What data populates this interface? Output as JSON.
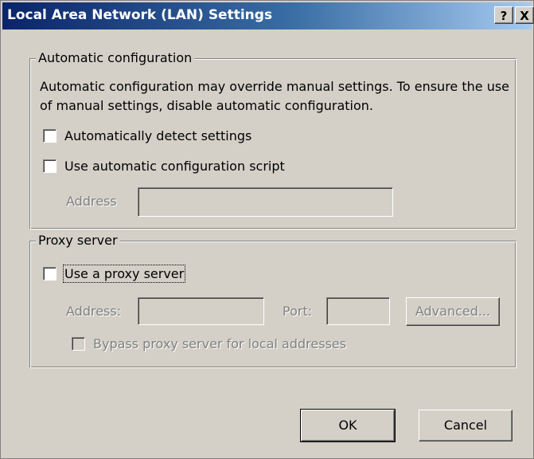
{
  "window": {
    "title": "Local Area Network (LAN) Settings",
    "help_label": "?",
    "close_label": "X"
  },
  "auto_config": {
    "legend": "Automatic configuration",
    "description": "Automatic configuration may override manual settings.  To ensure the use of manual settings, disable automatic configuration.",
    "auto_detect": {
      "label": "Automatically detect settings",
      "checked": false
    },
    "use_script": {
      "label": "Use automatic configuration script",
      "checked": false
    },
    "address_label": "Address",
    "address_value": ""
  },
  "proxy": {
    "legend": "Proxy server",
    "use_proxy": {
      "label": "Use a proxy server",
      "checked": false
    },
    "address_label": "Address:",
    "address_value": "",
    "port_label": "Port:",
    "port_value": "",
    "advanced_label": "Advanced...",
    "bypass": {
      "label": "Bypass proxy server for local addresses",
      "checked": false
    }
  },
  "buttons": {
    "ok_label": "OK",
    "cancel_label": "Cancel"
  },
  "colors": {
    "dialog_bg": "#d4d0c8",
    "titlebar_start": "#0a246a",
    "titlebar_end": "#a6caf0",
    "disabled_text": "#808080"
  }
}
